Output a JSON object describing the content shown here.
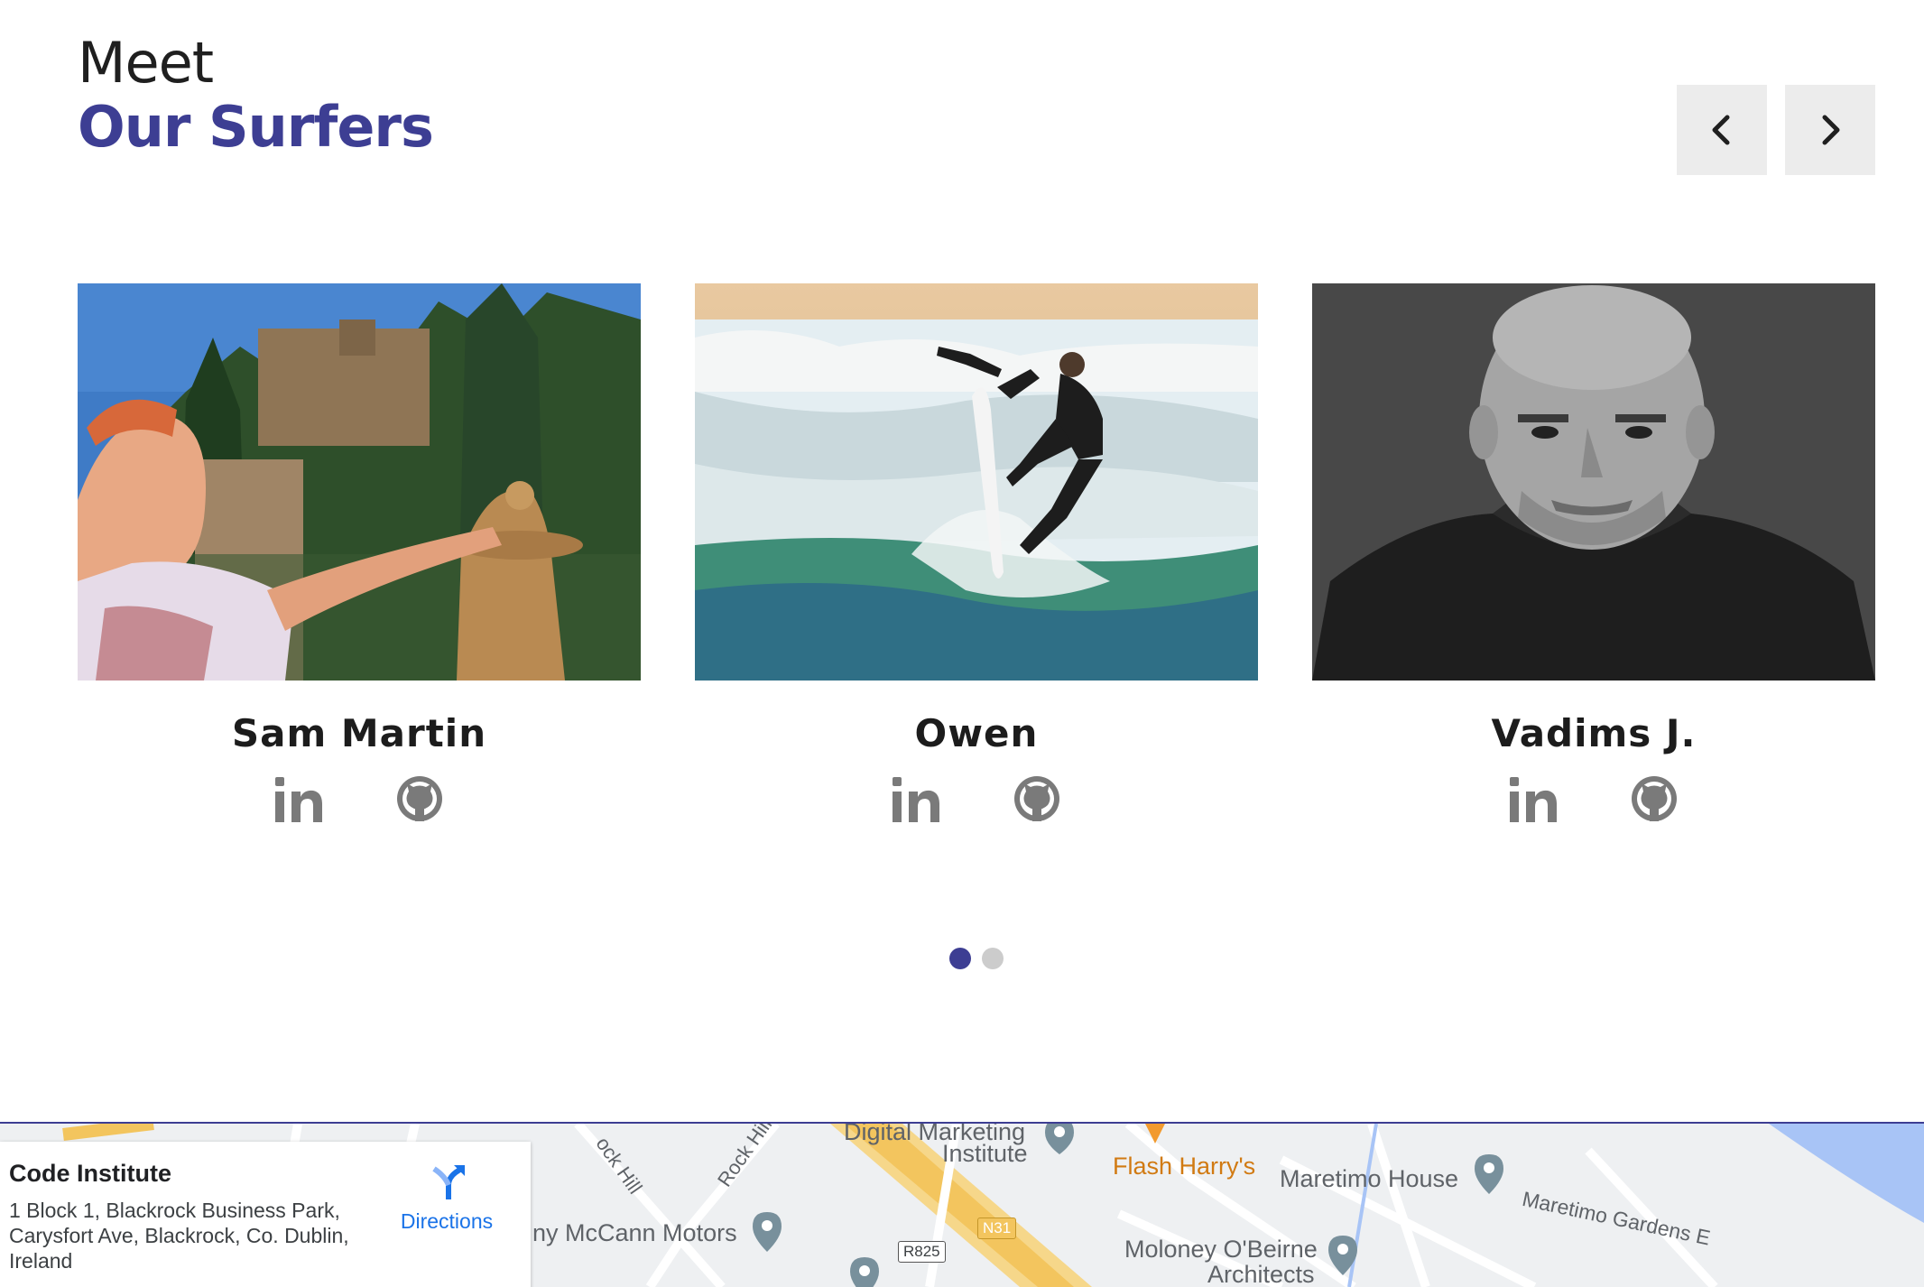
{
  "section": {
    "heading_line1": "Meet",
    "heading_line2": "Our Surfers"
  },
  "carousel": {
    "prev_icon": "chevron-left-icon",
    "next_icon": "chevron-right-icon",
    "active_page": 1,
    "page_count": 2
  },
  "surfers": [
    {
      "name": "Sam Martin",
      "linkedin_icon": "linkedin-icon",
      "github_icon": "github-icon"
    },
    {
      "name": "Owen",
      "linkedin_icon": "linkedin-icon",
      "github_icon": "github-icon"
    },
    {
      "name": "Vadims J.",
      "linkedin_icon": "linkedin-icon",
      "github_icon": "github-icon"
    }
  ],
  "map": {
    "place_name": "Code Institute",
    "address": "1 Block 1, Blackrock Business Park, Carysfort Ave, Blackrock, Co. Dublin, Ireland",
    "directions_label": "Directions",
    "labels": {
      "digital_marketing": "Digital Marketing",
      "institute": "Institute",
      "flash_harrys": "Flash Harry's",
      "maretimo_house": "Maretimo House",
      "maretimo_gardens": "Maretimo Gardens E",
      "mccann": "ny McCann Motors",
      "moloney": "Moloney O'Beirne",
      "architects": "Architects",
      "rock_hill_1": "Rock Hill",
      "rock_hill_2": "ock Hill",
      "road_n31": "N31",
      "road_r825": "R825"
    }
  },
  "colors": {
    "accent": "#3d3e93",
    "text_dark": "#1c1c1c",
    "icon_gray": "#7a7a7a",
    "button_bg": "#ececec",
    "dot_inactive": "#cccccc",
    "map_link": "#1a73e8"
  }
}
